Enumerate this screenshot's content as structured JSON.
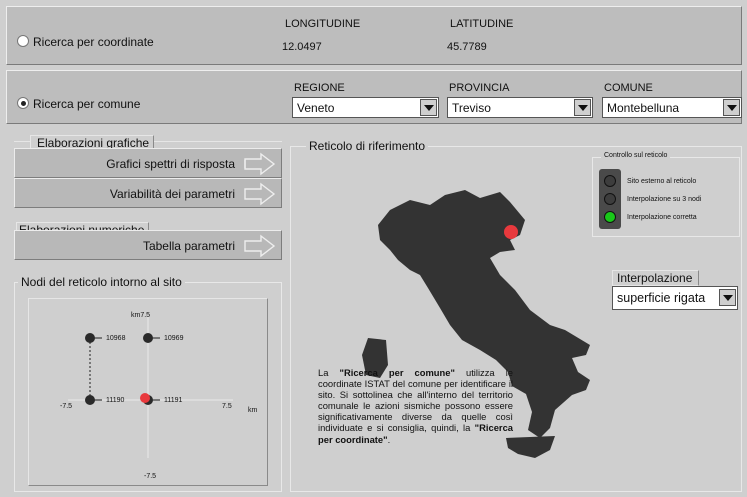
{
  "coord_section": {
    "radio_label": "Ricerca per coordinate",
    "longitude_header": "LONGITUDINE",
    "longitude_value": "12.0497",
    "latitude_header": "LATITUDINE",
    "latitude_value": "45.7789",
    "selected": false
  },
  "comune_section": {
    "radio_label": "Ricerca per comune",
    "selected": true,
    "regione": {
      "header": "REGIONE",
      "value": "Veneto"
    },
    "provincia": {
      "header": "PROVINCIA",
      "value": "Treviso"
    },
    "comune": {
      "header": "COMUNE",
      "value": "Montebelluna"
    }
  },
  "elab_grafiche": {
    "title": "Elaborazioni grafiche",
    "button1": "Grafici spettri di risposta",
    "button2": "Variabilità dei parametri"
  },
  "elab_numeriche": {
    "title": "Elaborazioni numeriche",
    "button1": "Tabella parametri"
  },
  "nodi": {
    "title": "Nodi del reticolo intorno al sito",
    "axis_top": "km7.5",
    "axis_left": "-7.5",
    "axis_right": "7.5",
    "axis_unit": "km",
    "axis_bottom": "-7.5",
    "node_ul": "10968",
    "node_ur": "10969",
    "node_ll": "11190",
    "node_lr": "11191"
  },
  "reticolo": {
    "title": "Reticolo di riferimento",
    "controllo": {
      "title": "Controllo sul reticolo",
      "items": [
        {
          "label": "Sito esterno al reticolo",
          "color": "#3d3d3d"
        },
        {
          "label": "Interpolazione su 3 nodi",
          "color": "#3d3d3d"
        },
        {
          "label": "Interpolazione corretta",
          "color": "#19c819"
        }
      ]
    },
    "interpolazione": {
      "title": "Interpolazione",
      "value": "superficie rigata"
    },
    "note_parts": {
      "p1": "La ",
      "b1": "\"Ricerca per comune\"",
      "p2": " utilizza le coordinate ISTAT del comune per identificare il sito. Si sottolinea che all'interno del territorio comunale le azioni sismiche possono essere significativamente diverse da quelle così individuate e si consiglia, quindi, la ",
      "b2": "\"Ricerca per coordinate\"",
      "p3": "."
    }
  },
  "colors": {
    "site_marker": "#e8393d",
    "map_fill": "#333333",
    "led_on": "#19c819",
    "led_off": "#3d3d3d"
  }
}
